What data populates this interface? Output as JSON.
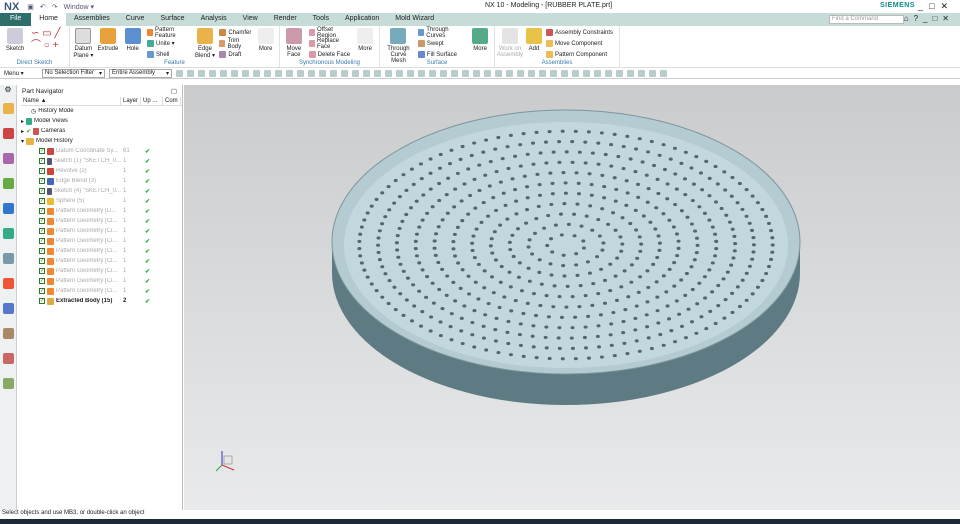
{
  "app": {
    "logo": "NX",
    "quick_access": "Window ▾",
    "title": "NX 10 - Modeling - [RUBBER PLATE.prt]",
    "brand": "SIEMENS"
  },
  "tabs": [
    "File",
    "Home",
    "Assemblies",
    "Curve",
    "Surface",
    "Analysis",
    "View",
    "Render",
    "Tools",
    "Application",
    "Mold Wizard"
  ],
  "find_command_placeholder": "Find a Command",
  "ribbon": {
    "direct_sketch": {
      "label": "Direct Sketch",
      "sketch": "Sketch"
    },
    "feature": {
      "label": "Feature",
      "datum_plane": "Datum Plane ▾",
      "extrude": "Extrude",
      "hole": "Hole",
      "pattern_feature": "Pattern Feature",
      "unite": "Unite ▾",
      "shell": "Shell",
      "edge_blend": "Edge Blend ▾",
      "chamfer": "Chamfer",
      "trim_body": "Trim Body",
      "draft": "Draft",
      "more": "More"
    },
    "sync": {
      "label": "Synchronous Modeling",
      "move_face": "Move Face",
      "offset_region": "Offset Region",
      "replace_face": "Replace Face",
      "delete_face": "Delete Face",
      "more": "More"
    },
    "surface": {
      "label": "Surface",
      "through_curve_mesh": "Through Curve Mesh",
      "through_curves": "Through Curves",
      "swept": "Swept",
      "fill_surface": "Fill Surface",
      "more": "More"
    },
    "assemblies": {
      "label": "Assemblies",
      "work_on_assembly": "Work on Assembly",
      "add": "Add",
      "assembly_constraints": "Assembly Constraints",
      "move_component": "Move Component",
      "pattern_component": "Pattern Component"
    }
  },
  "toolbar": {
    "menu": "Menu ▾",
    "selection_filter": "No Selection Filter",
    "scope": "Entire Assembly"
  },
  "navigator": {
    "title": "Part Navigator",
    "columns": [
      "Name ▲",
      "Layer",
      "Up ...",
      "Com"
    ],
    "top_items": [
      "History Mode",
      "Model Views",
      "Cameras",
      "Model History"
    ],
    "features": [
      {
        "name": "Datum Coordinate Sy...",
        "layer": "61",
        "up": "✔",
        "color": "#c44"
      },
      {
        "name": "Sketch (1) \"SKETCH_0...",
        "layer": "1",
        "up": "✔",
        "color": "#557"
      },
      {
        "name": "Revolve (2)",
        "layer": "1",
        "up": "✔",
        "color": "#c43"
      },
      {
        "name": "Edge Blend (3)",
        "layer": "1",
        "up": "✔",
        "color": "#46b"
      },
      {
        "name": "Sketch (4) \"SKETCH_0...",
        "layer": "1",
        "up": "✔",
        "color": "#557"
      },
      {
        "name": "Sphere (5)",
        "layer": "1",
        "up": "✔",
        "color": "#eb3"
      },
      {
        "name": "Pattern Geometry [Li...",
        "layer": "1",
        "up": "✔",
        "color": "#e83"
      },
      {
        "name": "Pattern Geometry [Ci...",
        "layer": "1",
        "up": "✔",
        "color": "#e83"
      },
      {
        "name": "Pattern Geometry [Ci...",
        "layer": "1",
        "up": "✔",
        "color": "#e83"
      },
      {
        "name": "Pattern Geometry [Ci...",
        "layer": "1",
        "up": "✔",
        "color": "#e83"
      },
      {
        "name": "Pattern Geometry [Ci...",
        "layer": "1",
        "up": "✔",
        "color": "#e83"
      },
      {
        "name": "Pattern Geometry [Ci...",
        "layer": "1",
        "up": "✔",
        "color": "#e83"
      },
      {
        "name": "Pattern Geometry [Ci...",
        "layer": "1",
        "up": "✔",
        "color": "#e83"
      },
      {
        "name": "Pattern Geometry [Ci...",
        "layer": "1",
        "up": "✔",
        "color": "#e83"
      },
      {
        "name": "Pattern Geometry [Ci...",
        "layer": "1",
        "up": "✔",
        "color": "#e83"
      },
      {
        "name": "Extracted Body (15)",
        "layer": "2",
        "up": "✔",
        "color": "#da4",
        "bold": true
      }
    ]
  },
  "status": "Select objects and use MB3, or double-click an object"
}
